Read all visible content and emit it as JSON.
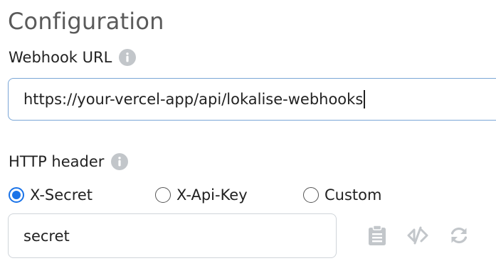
{
  "section": {
    "title": "Configuration"
  },
  "webhook": {
    "label": "Webhook URL",
    "info_icon": "info-icon",
    "value": "https://your-vercel-app/api/lokalise-webhooks"
  },
  "http_header": {
    "label": "HTTP header",
    "info_icon": "info-icon",
    "options": [
      {
        "label": "X-Secret",
        "selected": true
      },
      {
        "label": "X-Api-Key",
        "selected": false
      },
      {
        "label": "Custom",
        "selected": false
      }
    ],
    "secret_value": "secret",
    "actions": [
      {
        "icon": "clipboard-icon"
      },
      {
        "icon": "eye-slash-icon"
      },
      {
        "icon": "refresh-icon"
      }
    ]
  },
  "colors": {
    "accent": "#1a73e8",
    "focus_border": "#7aa6d6",
    "muted_icon": "#c2c6ca",
    "title": "#5a5a5a"
  }
}
